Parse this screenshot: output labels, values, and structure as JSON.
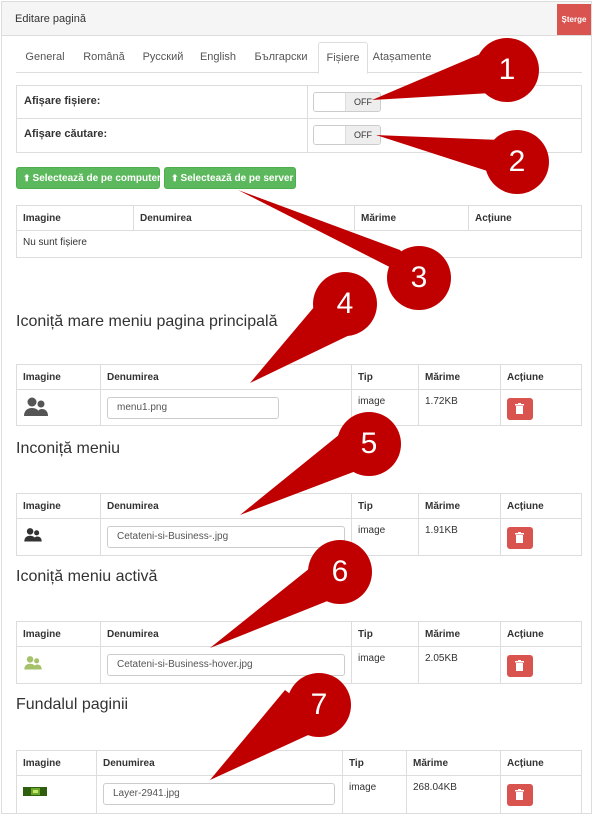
{
  "header": {
    "title": "Editare pagină",
    "delete_label": "Șterge"
  },
  "tabs": [
    {
      "label": "General"
    },
    {
      "label": "Română"
    },
    {
      "label": "Русский"
    },
    {
      "label": "English"
    },
    {
      "label": "Български"
    },
    {
      "label": "Fișiere",
      "active": true
    },
    {
      "label": "Atașamente"
    }
  ],
  "settings": {
    "show_files": {
      "label": "Afișare fișiere:",
      "value": "OFF"
    },
    "show_search": {
      "label": "Afișare căutare:",
      "value": "OFF"
    }
  },
  "buttons": {
    "from_computer": "Selectează de pe computer",
    "from_server": "Selectează de pe server"
  },
  "files_table": {
    "headers": [
      "Imagine",
      "Denumirea",
      "",
      "Mărime",
      "Acțiune"
    ],
    "empty": "Nu sunt fișiere"
  },
  "columns": {
    "image": "Imagine",
    "name": "Denumirea",
    "type": "Tip",
    "size": "Mărime",
    "action": "Acțiune"
  },
  "sections": [
    {
      "title": "Iconiță mare meniu pagina principală",
      "file": "menu1.png",
      "type": "image",
      "size": "1.72KB",
      "icon": "users-icon",
      "color": "#555555"
    },
    {
      "title": "Inconiță meniu",
      "file": "Cetateni-si-Business-.jpg",
      "type": "image",
      "size": "1.91KB",
      "icon": "users-icon",
      "color": "#333333"
    },
    {
      "title": "Iconiță meniu activă",
      "file": "Cetateni-si-Business-hover.jpg",
      "type": "image",
      "size": "2.05KB",
      "icon": "users-icon",
      "color": "#a5c26b"
    },
    {
      "title": "Fundalul paginii",
      "file": "Layer-2941.jpg",
      "type": "image",
      "size": "268.04KB",
      "icon": "background-thumbnail",
      "color": "#3b6e12"
    }
  ],
  "callouts": [
    "1",
    "2",
    "3",
    "4",
    "5",
    "6",
    "7"
  ],
  "colors": {
    "danger": "#d9534f",
    "success": "#5cb85c",
    "callout": "#c00000"
  }
}
